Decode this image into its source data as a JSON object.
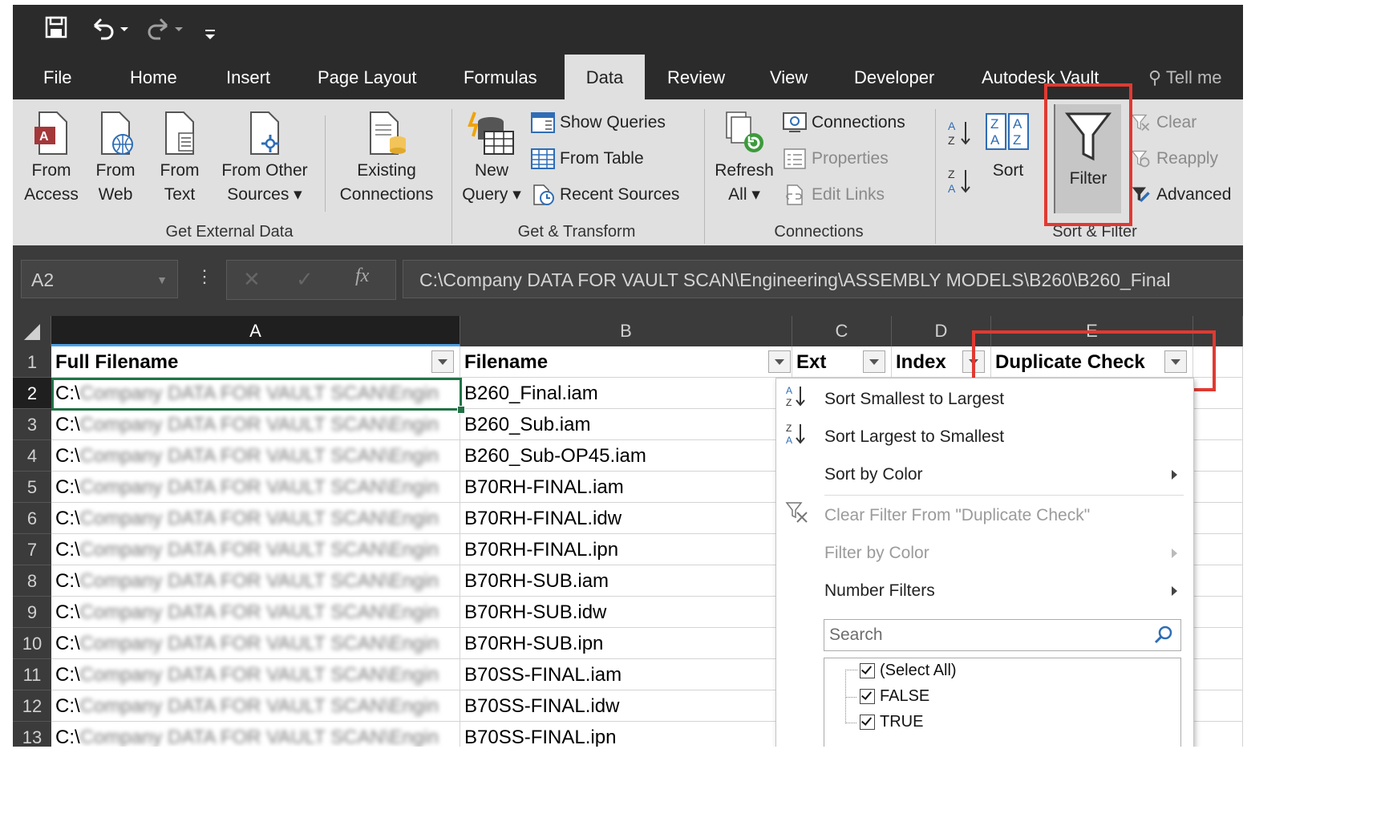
{
  "qat": {
    "save_icon": "save-icon",
    "undo_icon": "undo-icon",
    "redo_icon": "redo-icon",
    "customize_icon": "customize-qat-icon"
  },
  "tabs": [
    {
      "label": "File"
    },
    {
      "label": "Home"
    },
    {
      "label": "Insert"
    },
    {
      "label": "Page Layout"
    },
    {
      "label": "Formulas"
    },
    {
      "label": "Data"
    },
    {
      "label": "Review"
    },
    {
      "label": "View"
    },
    {
      "label": "Developer"
    },
    {
      "label": "Autodesk Vault"
    },
    {
      "label": "Tell me"
    }
  ],
  "active_tab": "Data",
  "ribbon": {
    "get_external": {
      "label": "Get External Data",
      "from_access": [
        "From",
        "Access"
      ],
      "from_web": [
        "From",
        "Web"
      ],
      "from_text": [
        "From",
        "Text"
      ],
      "from_other": [
        "From Other",
        "Sources ▾"
      ],
      "existing": [
        "Existing",
        "Connections"
      ]
    },
    "get_transform": {
      "label": "Get & Transform",
      "new_query": [
        "New",
        "Query ▾"
      ],
      "show_queries": "Show Queries",
      "from_table": "From Table",
      "recent_sources": "Recent Sources"
    },
    "connections": {
      "label": "Connections",
      "refresh": [
        "Refresh",
        "All ▾"
      ],
      "connections": "Connections",
      "properties": "Properties",
      "edit_links": "Edit Links"
    },
    "sort_filter": {
      "label": "Sort & Filter",
      "sort": "Sort",
      "filter": "Filter",
      "clear": "Clear",
      "reapply": "Reapply",
      "advanced": "Advanced"
    }
  },
  "formula_bar": {
    "name_box": "A2",
    "formula": "C:\\Company DATA FOR VAULT SCAN\\Engineering\\ASSEMBLY MODELS\\B260\\B260_Final"
  },
  "columns": [
    "A",
    "B",
    "C",
    "D",
    "E"
  ],
  "headers": [
    "Full Filename",
    "Filename",
    "Ext",
    "Index",
    "Duplicate Check"
  ],
  "rows": [
    {
      "n": "1"
    },
    {
      "n": "2",
      "a_prefix": "C:\\",
      "a_blur": "Company DATA FOR VAULT SCAN\\Engin",
      "b": "B260_Final.iam"
    },
    {
      "n": "3",
      "a_prefix": "C:\\",
      "a_blur": "Company DATA FOR VAULT SCAN\\Engin",
      "b": "B260_Sub.iam"
    },
    {
      "n": "4",
      "a_prefix": "C:\\",
      "a_blur": "Company DATA FOR VAULT SCAN\\Engin",
      "b": "B260_Sub-OP45.iam"
    },
    {
      "n": "5",
      "a_prefix": "C:\\",
      "a_blur": "Company DATA FOR VAULT SCAN\\Engin",
      "b": "B70RH-FINAL.iam"
    },
    {
      "n": "6",
      "a_prefix": "C:\\",
      "a_blur": "Company DATA FOR VAULT SCAN\\Engin",
      "b": "B70RH-FINAL.idw"
    },
    {
      "n": "7",
      "a_prefix": "C:\\",
      "a_blur": "Company DATA FOR VAULT SCAN\\Engin",
      "b": "B70RH-FINAL.ipn"
    },
    {
      "n": "8",
      "a_prefix": "C:\\",
      "a_blur": "Company DATA FOR VAULT SCAN\\Engin",
      "b": "B70RH-SUB.iam"
    },
    {
      "n": "9",
      "a_prefix": "C:\\",
      "a_blur": "Company DATA FOR VAULT SCAN\\Engin",
      "b": "B70RH-SUB.idw"
    },
    {
      "n": "10",
      "a_prefix": "C:\\",
      "a_blur": "Company DATA FOR VAULT SCAN\\Engin",
      "b": "B70RH-SUB.ipn"
    },
    {
      "n": "11",
      "a_prefix": "C:\\",
      "a_blur": "Company DATA FOR VAULT SCAN\\Engin",
      "b": "B70SS-FINAL.iam"
    },
    {
      "n": "12",
      "a_prefix": "C:\\",
      "a_blur": "Company DATA FOR VAULT SCAN\\Engin",
      "b": "B70SS-FINAL.idw"
    },
    {
      "n": "13",
      "a_prefix": "C:\\",
      "a_blur": "Company DATA FOR VAULT SCAN\\Engin",
      "b": "B70SS-FINAL.ipn"
    }
  ],
  "filter_menu": {
    "sort_asc": "Sort Smallest to Largest",
    "sort_desc": "Sort Largest to Smallest",
    "sort_color": "Sort by Color",
    "clear_filter": "Clear Filter From \"Duplicate Check\"",
    "filter_color": "Filter by Color",
    "number_filters": "Number Filters",
    "search_placeholder": "Search",
    "values": [
      "(Select All)",
      "FALSE",
      "TRUE"
    ]
  },
  "colors": {
    "ribbon_dark": "#2b2b2b",
    "ribbon": "#e0e0e0",
    "highlight": "#e03a32",
    "excel_green": "#217346"
  }
}
